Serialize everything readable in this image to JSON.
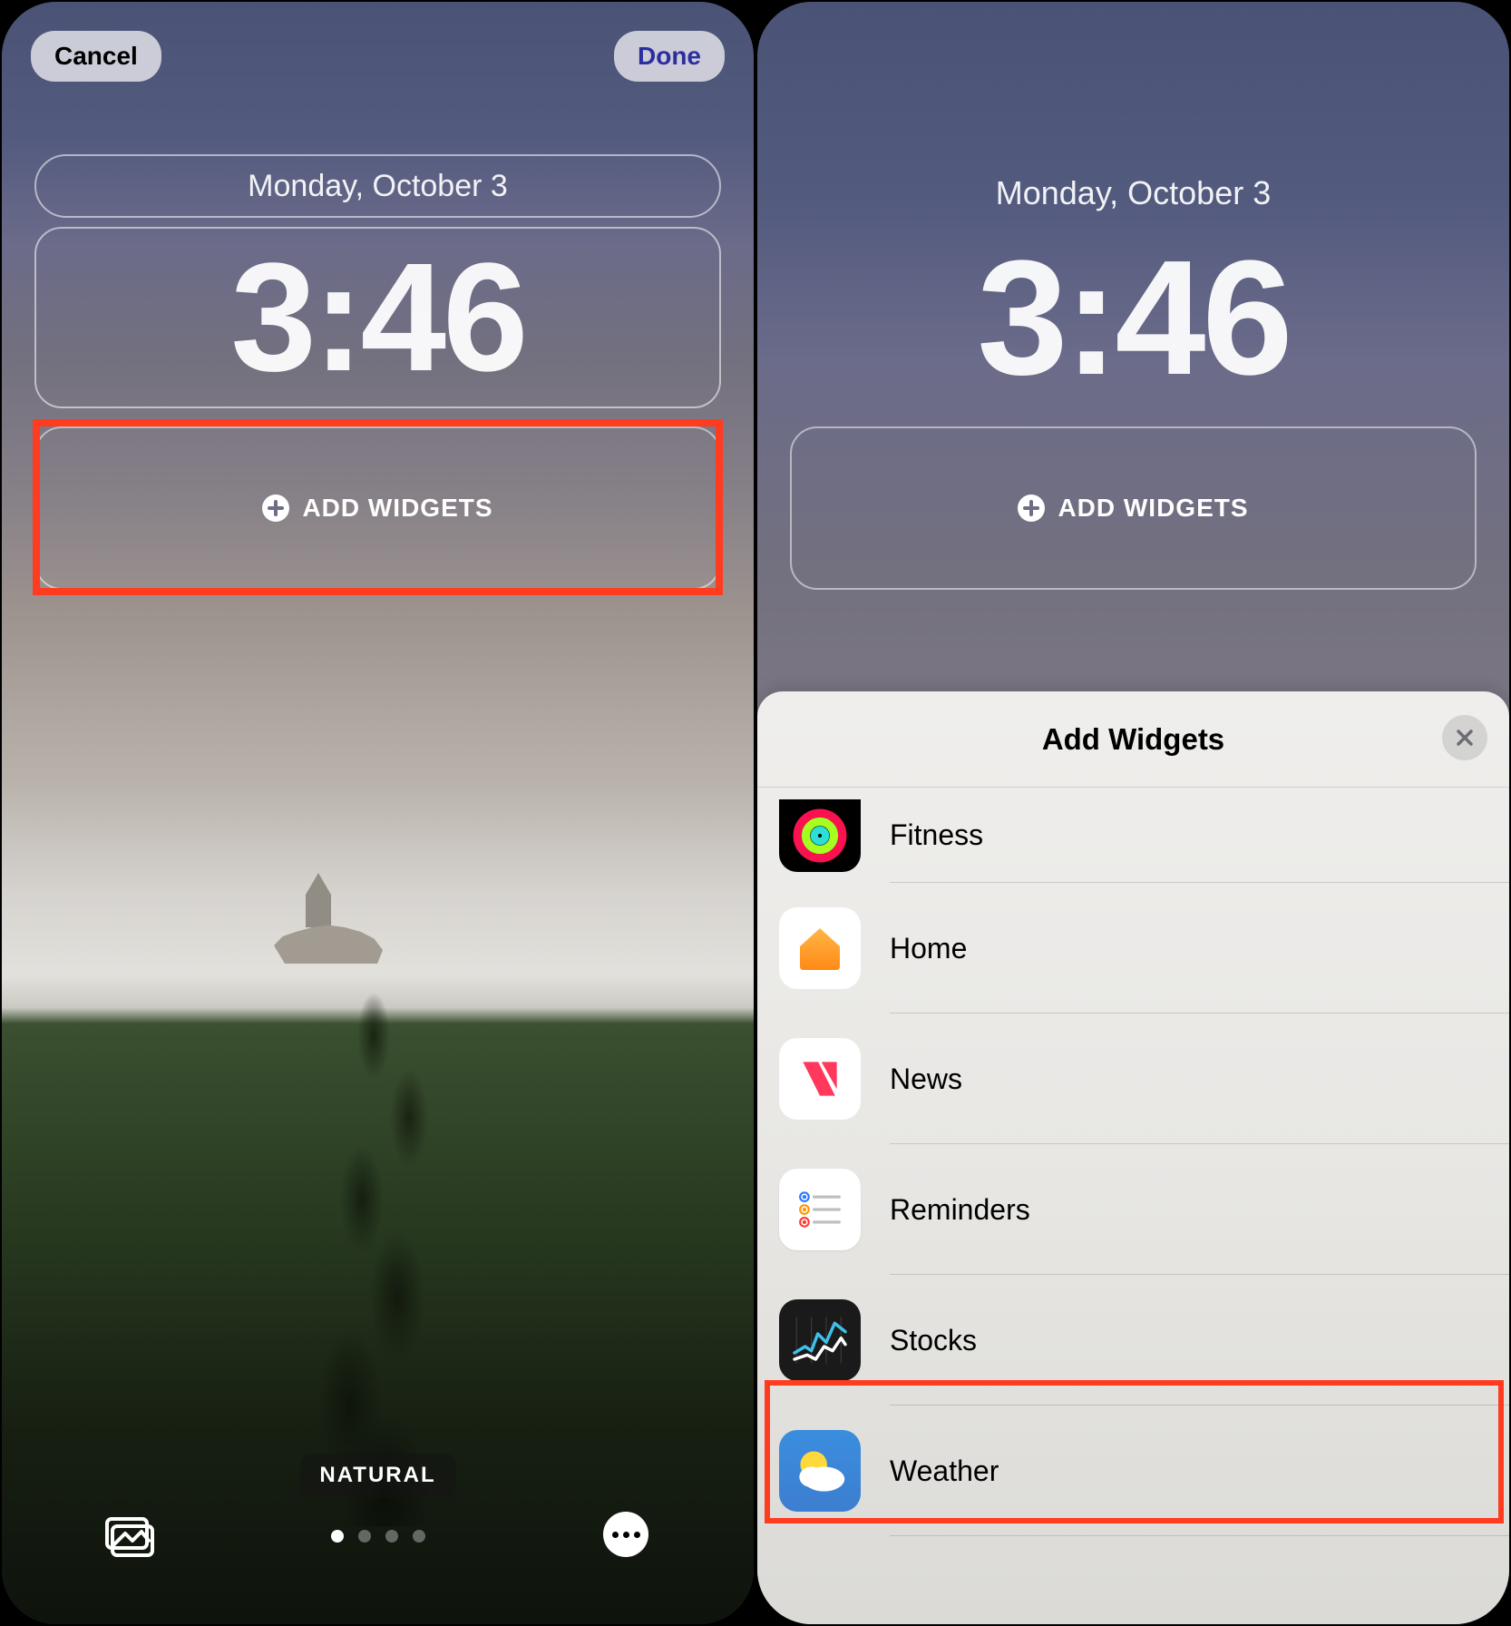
{
  "left": {
    "buttons": {
      "cancel": "Cancel",
      "done": "Done"
    },
    "date": "Monday, October 3",
    "time": "3:46",
    "add_widgets_label": "ADD WIDGETS",
    "filter_label": "NATURAL",
    "page_dots": {
      "count": 4,
      "active": 0
    }
  },
  "right": {
    "date": "Monday, October 3",
    "time": "3:46",
    "add_widgets_label": "ADD WIDGETS",
    "sheet": {
      "title": "Add Widgets",
      "items": [
        {
          "label": "Fitness",
          "icon": "fitness-icon"
        },
        {
          "label": "Home",
          "icon": "home-icon"
        },
        {
          "label": "News",
          "icon": "news-icon"
        },
        {
          "label": "Reminders",
          "icon": "reminders-icon"
        },
        {
          "label": "Stocks",
          "icon": "stocks-icon"
        },
        {
          "label": "Weather",
          "icon": "weather-icon"
        }
      ],
      "highlighted": "Weather"
    }
  },
  "highlight_color": "#ff3b20"
}
